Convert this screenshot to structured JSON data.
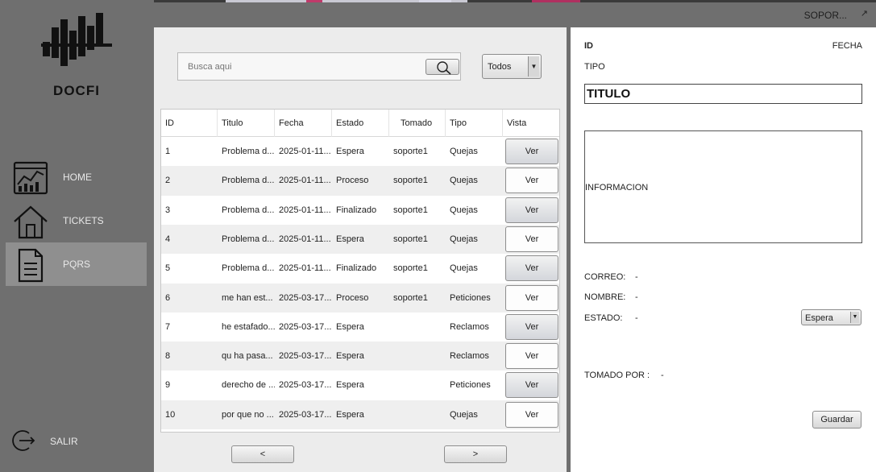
{
  "header": {
    "user_label": "SOPOR...",
    "minimize_symbol": "↗"
  },
  "sidebar": {
    "logo_text": "DOCFI",
    "items": [
      {
        "label": "HOME",
        "icon": "dashboard-chart-icon",
        "active": false
      },
      {
        "label": "TICKETS",
        "icon": "house-icon",
        "active": false
      },
      {
        "label": "PQRS",
        "icon": "document-icon",
        "active": true
      }
    ],
    "logout_label": "SALIR"
  },
  "search": {
    "placeholder": "Busca aqui",
    "filter_value": "Todos"
  },
  "table": {
    "columns": [
      "ID",
      "Titulo",
      "Fecha",
      "Estado",
      "Tomado",
      "Tipo",
      "Vista"
    ],
    "button_label": "Ver",
    "rows": [
      {
        "id": "1",
        "titulo": "Problema d...",
        "fecha": "2025-01-11...",
        "estado": "Espera",
        "tomado": "soporte1",
        "tipo": "Quejas"
      },
      {
        "id": "2",
        "titulo": "Problema d...",
        "fecha": "2025-01-11...",
        "estado": "Proceso",
        "tomado": "soporte1",
        "tipo": "Quejas"
      },
      {
        "id": "3",
        "titulo": "Problema d...",
        "fecha": "2025-01-11...",
        "estado": "Finalizado",
        "tomado": "soporte1",
        "tipo": "Quejas"
      },
      {
        "id": "4",
        "titulo": "Problema d...",
        "fecha": "2025-01-11...",
        "estado": "Espera",
        "tomado": "soporte1",
        "tipo": "Quejas"
      },
      {
        "id": "5",
        "titulo": "Problema d...",
        "fecha": "2025-01-11...",
        "estado": "Finalizado",
        "tomado": "soporte1",
        "tipo": "Quejas"
      },
      {
        "id": "6",
        "titulo": "me han est...",
        "fecha": "2025-03-17...",
        "estado": "Proceso",
        "tomado": "soporte1",
        "tipo": "Peticiones"
      },
      {
        "id": "7",
        "titulo": "he estafado...",
        "fecha": "2025-03-17...",
        "estado": "Espera",
        "tomado": "",
        "tipo": "Reclamos"
      },
      {
        "id": "8",
        "titulo": "qu ha pasa...",
        "fecha": "2025-03-17...",
        "estado": "Espera",
        "tomado": "",
        "tipo": "Reclamos"
      },
      {
        "id": "9",
        "titulo": "derecho de ...",
        "fecha": "2025-03-17...",
        "estado": "Espera",
        "tomado": "",
        "tipo": "Peticiones"
      },
      {
        "id": "10",
        "titulo": "por que no ...",
        "fecha": "2025-03-17...",
        "estado": "Espera",
        "tomado": "",
        "tipo": "Quejas"
      }
    ]
  },
  "pagination": {
    "prev_label": "<",
    "next_label": ">"
  },
  "detail": {
    "id_label": "ID",
    "fecha_label": "FECHA",
    "tipo_label": "TIPO",
    "titulo": "TITULO",
    "informacion": "INFORMACION",
    "correo_label": "CORREO:",
    "correo_value": "-",
    "nombre_label": "NOMBRE:",
    "nombre_value": "-",
    "estado_label": "ESTADO:",
    "estado_value": "-",
    "estado_select": "Espera",
    "tomado_label": "TOMADO POR :",
    "tomado_value": "-",
    "save_label": "Guardar"
  }
}
